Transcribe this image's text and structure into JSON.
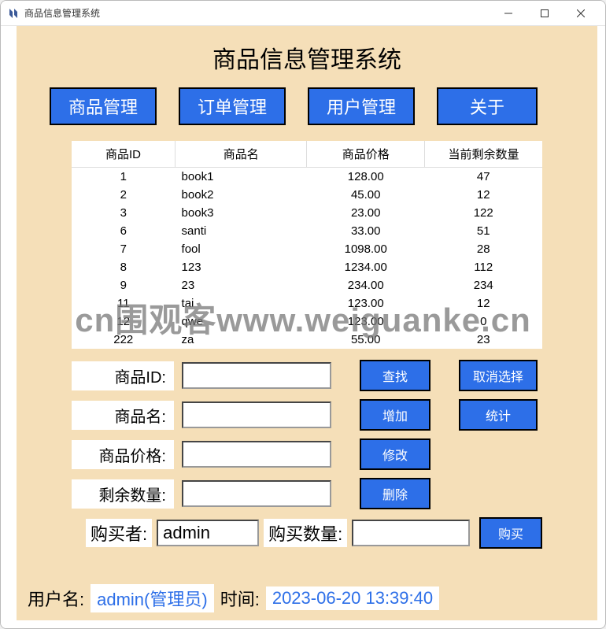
{
  "window": {
    "title": "商品信息管理系统"
  },
  "main_title": "商品信息管理系统",
  "menu": {
    "products": "商品管理",
    "orders": "订单管理",
    "users": "用户管理",
    "about": "关于"
  },
  "table": {
    "headers": [
      "商品ID",
      "商品名",
      "商品价格",
      "当前剩余数量"
    ],
    "rows": [
      {
        "id": "1",
        "name": "book1",
        "price": "128.00",
        "stock": "47"
      },
      {
        "id": "2",
        "name": "book2",
        "price": "45.00",
        "stock": "12"
      },
      {
        "id": "3",
        "name": "book3",
        "price": "23.00",
        "stock": "122"
      },
      {
        "id": "6",
        "name": "santi",
        "price": "33.00",
        "stock": "51"
      },
      {
        "id": "7",
        "name": "fool",
        "price": "1098.00",
        "stock": "28"
      },
      {
        "id": "8",
        "name": "123",
        "price": "1234.00",
        "stock": "112"
      },
      {
        "id": "9",
        "name": "23",
        "price": "234.00",
        "stock": "234"
      },
      {
        "id": "11",
        "name": "tai",
        "price": "123.00",
        "stock": "12"
      },
      {
        "id": "12",
        "name": "qwe",
        "price": "123.00",
        "stock": "0"
      },
      {
        "id": "222",
        "name": "za",
        "price": "55.00",
        "stock": "23"
      }
    ]
  },
  "form": {
    "id_label": "商品ID:",
    "name_label": "商品名:",
    "price_label": "商品价格:",
    "stock_label": "剩余数量:",
    "id_value": "",
    "name_value": "",
    "price_value": "",
    "stock_value": ""
  },
  "actions": {
    "search": "查找",
    "deselect": "取消选择",
    "add": "增加",
    "stats": "统计",
    "modify": "修改",
    "delete": "删除"
  },
  "buy": {
    "buyer_label": "购买者:",
    "buyer_value": "admin",
    "qty_label": "购买数量:",
    "qty_value": "",
    "buy_btn": "购买"
  },
  "status": {
    "user_label": "用户名:",
    "user_value": "admin(管理员)",
    "time_label": "时间:",
    "time_value": "2023-06-20 13:39:40"
  },
  "watermark": "cn围观客www.weiguanke.cn"
}
